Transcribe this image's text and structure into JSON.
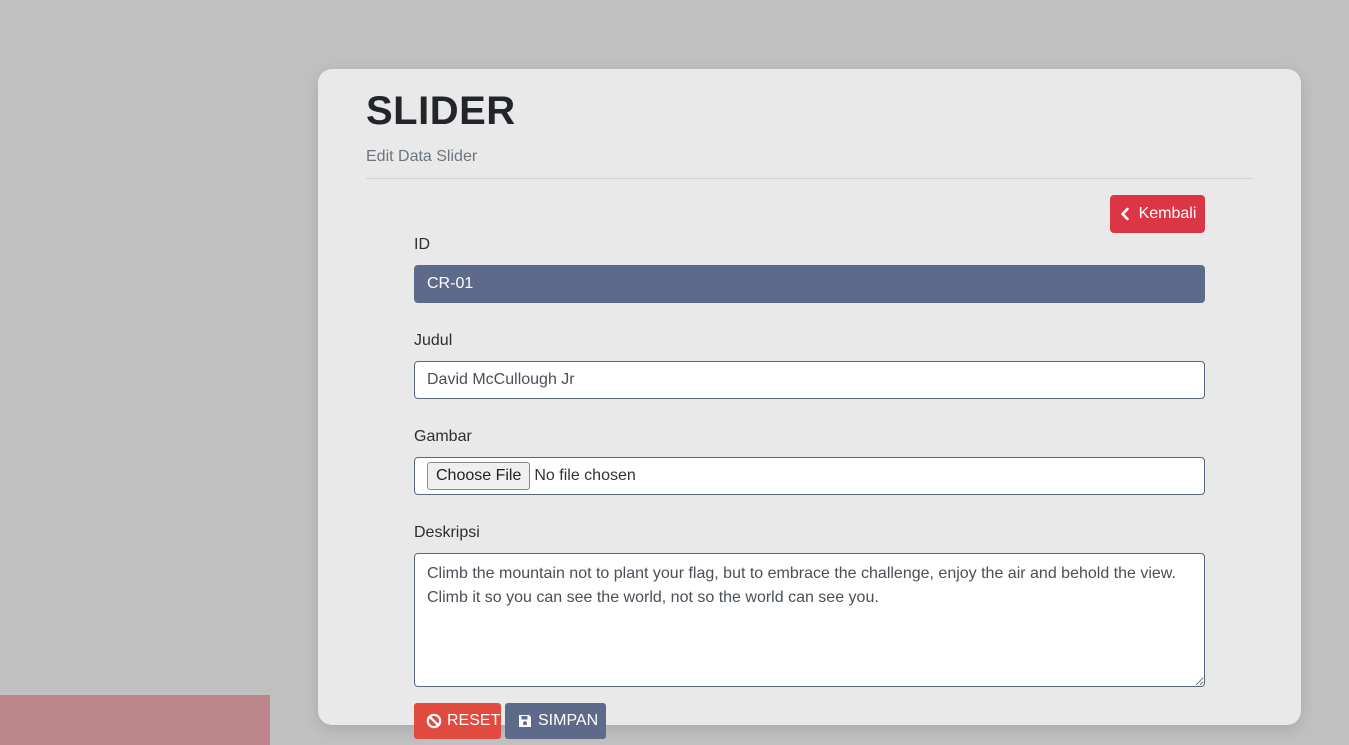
{
  "header": {
    "title": "SLIDER",
    "subtitle": "Edit Data Slider"
  },
  "back_button": {
    "label": "Kembali",
    "icon": "chevron-left-icon"
  },
  "form": {
    "id": {
      "label": "ID",
      "value": "CR-01"
    },
    "judul": {
      "label": "Judul",
      "value": "David McCullough Jr"
    },
    "gambar": {
      "label": "Gambar",
      "button_label": "Choose File",
      "status": "No file chosen"
    },
    "deskripsi": {
      "label": "Deskripsi",
      "value": "Climb the mountain not to plant your flag, but to embrace the challenge, enjoy the air and behold the view. Climb it so you can see the world, not so the world can see you."
    }
  },
  "actions": {
    "reset_label": "RESET",
    "save_label": "SIMPAN"
  },
  "colors": {
    "background": "#c0c0c0",
    "card": "#e9e9e9",
    "danger": "#dc3545",
    "reset": "#e04a3f",
    "primary": "#5d6a89",
    "side_block": "#bc868a"
  }
}
